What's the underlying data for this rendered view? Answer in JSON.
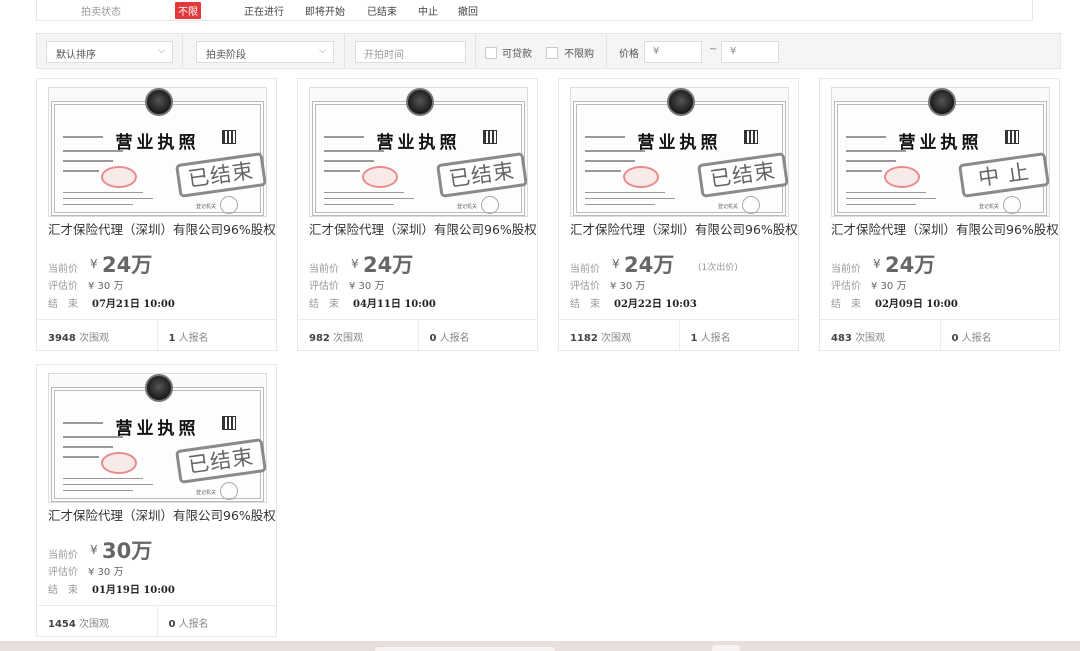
{
  "status_filter": {
    "label": "拍卖状态",
    "options": [
      "不限",
      "正在进行",
      "即将开始",
      "已结束",
      "中止",
      "撤回"
    ],
    "selected": "不限"
  },
  "filter_bar": {
    "sort_select": "默认排序",
    "stage_select": "拍卖阶段",
    "start_time_placeholder": "开拍时间",
    "loan_label": "可贷款",
    "no_limit_label": "不限购",
    "price_label": "价格",
    "price_min_placeholder": "¥",
    "price_max_placeholder": "¥",
    "dash": "~"
  },
  "cert": {
    "title": "营业执照",
    "footer": "登记机关"
  },
  "card_labels": {
    "current": "当前价",
    "eval": "评估价",
    "end": "结　束",
    "yen": "¥",
    "views_suffix": "次围观",
    "signup_suffix": "人报名"
  },
  "cards": [
    {
      "title": "汇才保险代理（深圳）有限公司96%股权",
      "stamp": "已结束",
      "price": "24万",
      "bids": "",
      "eval": "¥ 30 万",
      "end": "07月21日 10:00",
      "views": "3948",
      "signups": "1"
    },
    {
      "title": "汇才保险代理（深圳）有限公司96%股权",
      "stamp": "已结束",
      "price": "24万",
      "bids": "",
      "eval": "¥ 30 万",
      "end": "04月11日 10:00",
      "views": "982",
      "signups": "0"
    },
    {
      "title": "汇才保险代理（深圳）有限公司96%股权",
      "stamp": "已结束",
      "price": "24万",
      "bids": "(1次出价)",
      "eval": "¥ 30 万",
      "end": "02月22日 10:03",
      "views": "1182",
      "signups": "1"
    },
    {
      "title": "汇才保险代理（深圳）有限公司96%股权",
      "stamp": "中 止",
      "price": "24万",
      "bids": "",
      "eval": "¥ 30 万",
      "end": "02月09日 10:00",
      "views": "483",
      "signups": "0"
    },
    {
      "title": "汇才保险代理（深圳）有限公司96%股权",
      "stamp": "已结束",
      "price": "30万",
      "bids": "",
      "eval": "¥ 30 万",
      "end": "01月19日 10:00",
      "views": "1454",
      "signups": "0"
    }
  ]
}
